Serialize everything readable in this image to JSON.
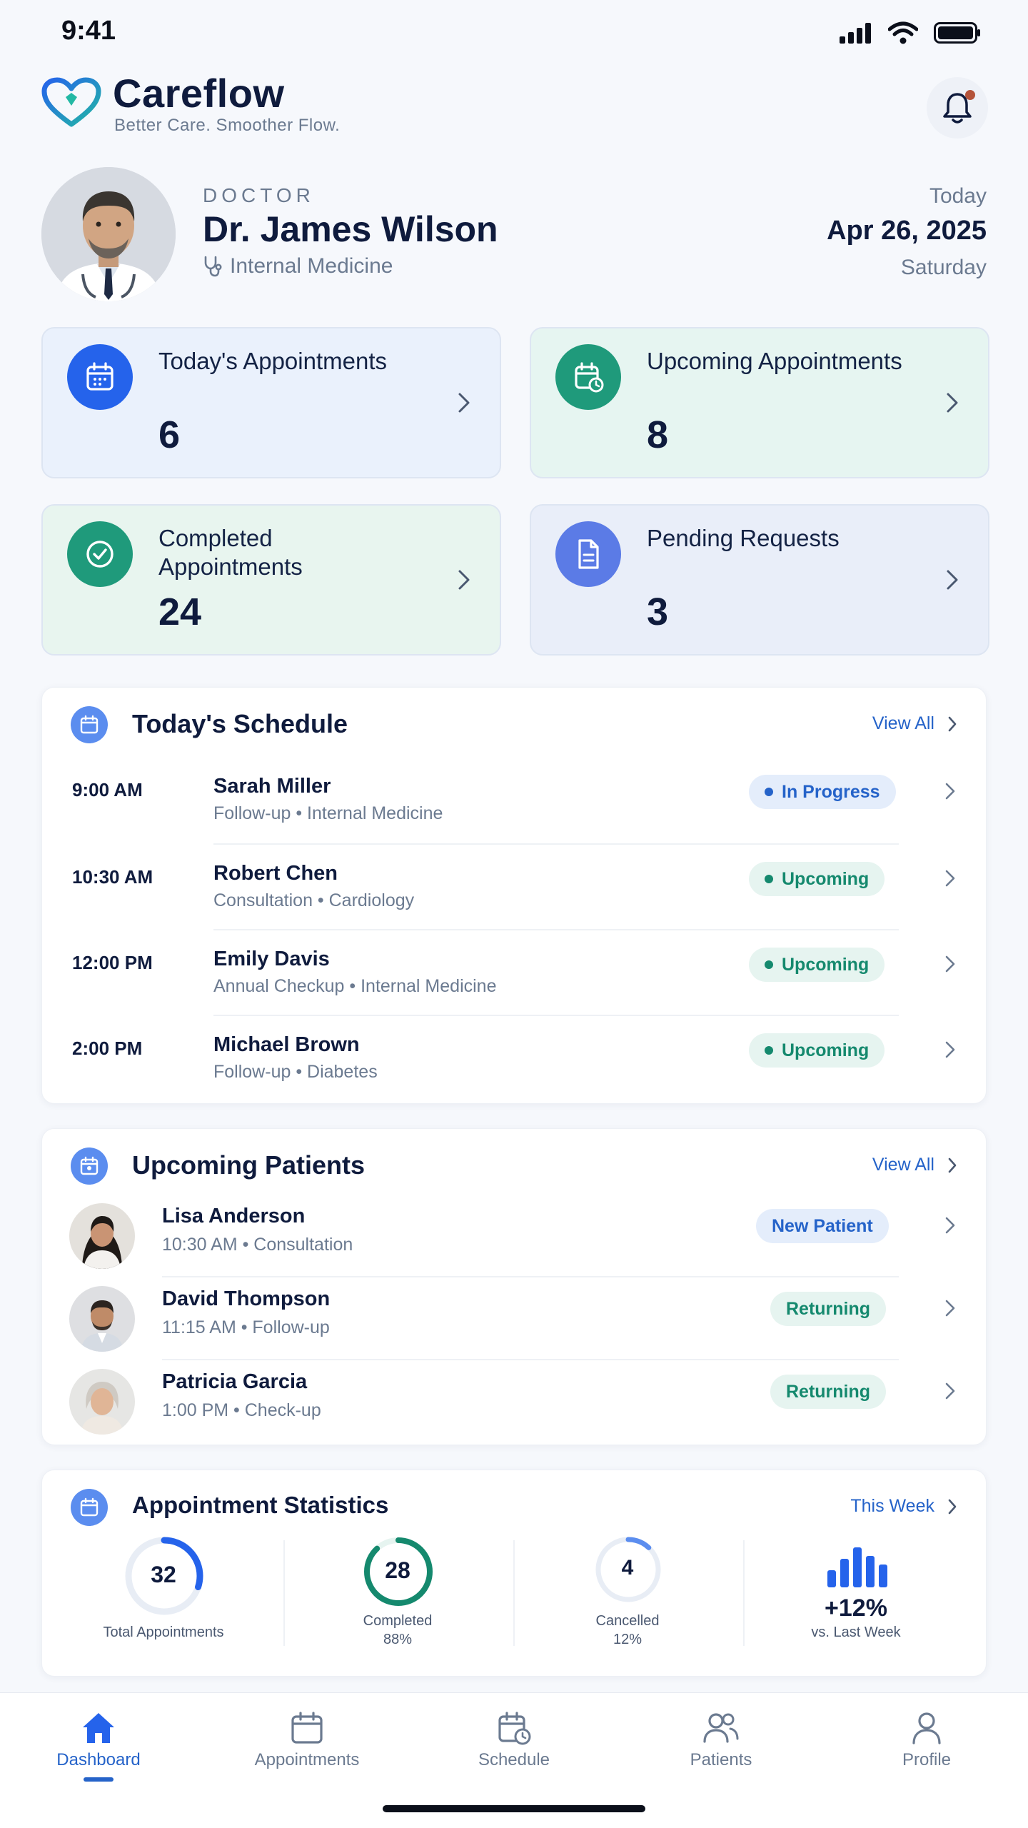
{
  "status_bar": {
    "time": "9:41"
  },
  "header": {
    "brand": "Careflow",
    "tagline": "Better Care. Smoother Flow."
  },
  "doctor": {
    "label": "DOCTOR",
    "name": "Dr. James Wilson",
    "specialty": "Internal Medicine"
  },
  "date": {
    "label": "Today",
    "value": "Apr 26, 2025",
    "day": "Saturday"
  },
  "stat_cards": [
    {
      "label": "Today's Appointments",
      "value": "6",
      "icon": "calendar-icon",
      "color": "#2563eb"
    },
    {
      "label": "Upcoming Appointments",
      "value": "8",
      "icon": "calendar-clock-icon",
      "color": "#1f9a7b"
    },
    {
      "label": "Completed Appointments",
      "value": "24",
      "icon": "check-circle-icon",
      "color": "#1f9a7b"
    },
    {
      "label": "Pending Requests",
      "value": "3",
      "icon": "document-icon",
      "color": "#5b7be6"
    }
  ],
  "schedule": {
    "title": "Today's Schedule",
    "view_all": "View All",
    "items": [
      {
        "time": "9:00 AM",
        "name": "Sarah Miller",
        "detail": "Follow-up • Internal Medicine",
        "status": "In Progress"
      },
      {
        "time": "10:30 AM",
        "name": "Robert Chen",
        "detail": "Consultation • Cardiology",
        "status": "Upcoming"
      },
      {
        "time": "12:00 PM",
        "name": "Emily Davis",
        "detail": "Annual Checkup • Internal Medicine",
        "status": "Upcoming"
      },
      {
        "time": "2:00 PM",
        "name": "Michael Brown",
        "detail": "Follow-up • Diabetes",
        "status": "Upcoming"
      }
    ]
  },
  "patients": {
    "title": "Upcoming Patients",
    "view_all": "View All",
    "items": [
      {
        "name": "Lisa Anderson",
        "detail": "10:30 AM • Consultation",
        "tag": "New Patient"
      },
      {
        "name": "David Thompson",
        "detail": "11:15 AM • Follow-up",
        "tag": "Returning"
      },
      {
        "name": "Patricia Garcia",
        "detail": "1:00 PM • Check-up",
        "tag": "Returning"
      }
    ]
  },
  "statistics": {
    "title": "Appointment Statistics",
    "period": "This Week",
    "total": {
      "value": "32",
      "label": "Total Appointments",
      "fill": 0.3
    },
    "completed": {
      "value": "28",
      "label": "Completed",
      "pct": "88%",
      "fill": 0.88
    },
    "cancelled": {
      "value": "4",
      "label": "Cancelled",
      "pct": "12%",
      "fill": 0.12
    },
    "trend": {
      "value": "+12%",
      "label": "vs. Last Week"
    }
  },
  "nav": [
    {
      "label": "Dashboard",
      "icon": "home-icon",
      "active": true
    },
    {
      "label": "Appointments",
      "icon": "calendar-icon"
    },
    {
      "label": "Schedule",
      "icon": "calendar-clock-icon"
    },
    {
      "label": "Patients",
      "icon": "users-icon"
    },
    {
      "label": "Profile",
      "icon": "user-icon"
    }
  ]
}
